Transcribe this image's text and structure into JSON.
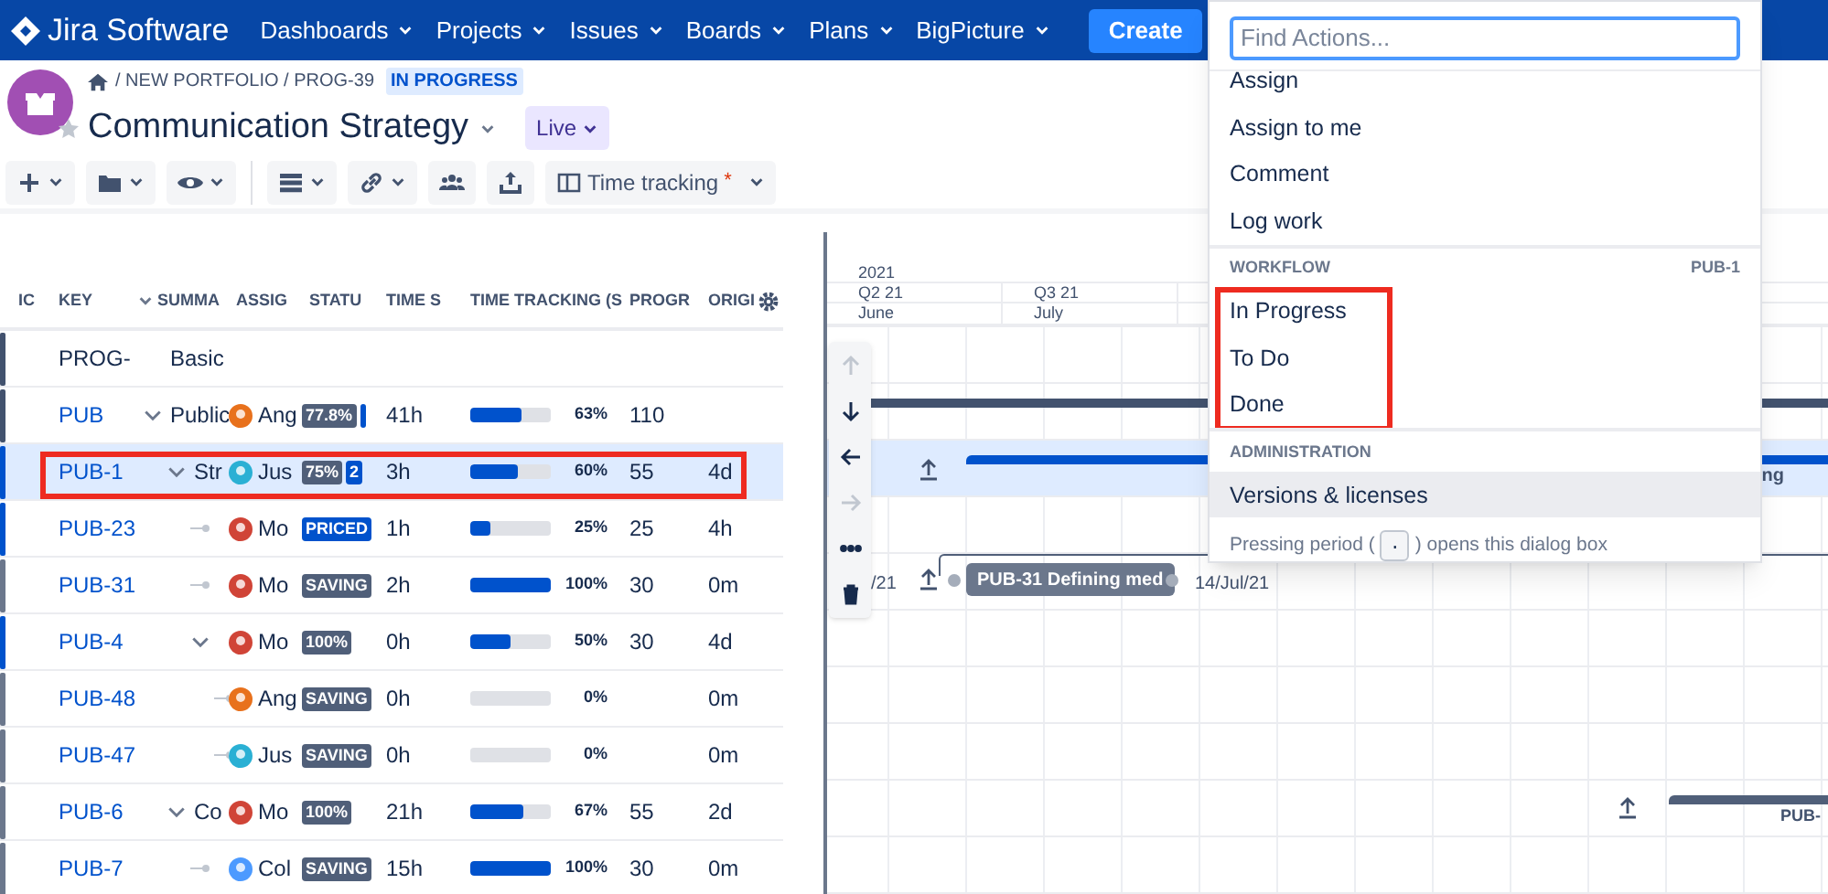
{
  "nav": {
    "logo": "Jira Software",
    "menus": [
      "Dashboards",
      "Projects",
      "Issues",
      "Boards",
      "Plans",
      "BigPicture"
    ],
    "create": "Create"
  },
  "header": {
    "breadcrumb": "/ NEW PORTFOLIO / PROG-39",
    "status": "IN PROGRESS",
    "title": "Communication Strategy",
    "mode": "Live"
  },
  "toolbar": [
    {
      "kind": "add",
      "dropdown": true
    },
    {
      "kind": "folder",
      "dropdown": true
    },
    {
      "kind": "view",
      "dropdown": true
    },
    {
      "kind": "divider"
    },
    {
      "kind": "rows",
      "dropdown": true
    },
    {
      "kind": "link",
      "dropdown": true
    },
    {
      "kind": "people",
      "dropdown": false
    },
    {
      "kind": "export",
      "dropdown": false
    },
    {
      "kind": "columns",
      "label": "Time tracking",
      "marker": "*",
      "dropdown": true
    }
  ],
  "table": {
    "columns": [
      "IC",
      "KEY",
      "SUMMA",
      "ASSIG",
      "STATU",
      "TIME S",
      "TIME TRACKING (S",
      "PROGR",
      "ORIGI"
    ],
    "rows": [
      {
        "kind": "program",
        "key": "PROG-",
        "summary": "Basic",
        "selected": false,
        "annotated": false,
        "color": "#42526e"
      },
      {
        "kind": "issue",
        "key": "PUB",
        "summary": "Public",
        "assignee": {
          "name": "Ang",
          "color": "#e8711c"
        },
        "status": [
          {
            "text": "77.8%",
            "color": "#505f79"
          },
          {
            "color": "#0052cc"
          }
        ],
        "time_spent": "41h",
        "level": 0.63,
        "percent": "63%",
        "progress": "110",
        "selected": false,
        "annotated": false,
        "color": "#42526e",
        "expanded": true,
        "children": [
          {
            "kind": "issue",
            "key": "PUB-1",
            "summary": "Str",
            "assignee": {
              "name": "Jus",
              "color": "#2ab0d4"
            },
            "status": [
              {
                "text": "75%",
                "color": "#505f79"
              },
              {
                "text": "2",
                "color": "#0052cc"
              }
            ],
            "time_spent": "3h",
            "level": 0.6,
            "percent": "60%",
            "progress": "55",
            "original": "4d",
            "selected": true,
            "annotated": true,
            "color": "#0052cc",
            "expanded": true,
            "children": [
              {
                "kind": "issue",
                "key": "PUB-23",
                "assignee": {
                  "name": "Mo",
                  "color": "#d04437"
                },
                "status": [
                  {
                    "text": "PRICED",
                    "color": "#0052cc"
                  }
                ],
                "time_spent": "1h",
                "level": 0.25,
                "percent": "25%",
                "progress": "25",
                "original": "4h",
                "selected": false,
                "annotated": false,
                "color": "#0052cc"
              },
              {
                "kind": "issue",
                "key": "PUB-31",
                "assignee": {
                  "name": "Mo",
                  "color": "#d04437"
                },
                "status": [
                  {
                    "text": "SAVING",
                    "color": "#505f79"
                  }
                ],
                "time_spent": "2h",
                "level": 1,
                "percent": "100%",
                "progress": "30",
                "original": "0m",
                "selected": false,
                "annotated": false,
                "color": "#6b778c"
              },
              {
                "kind": "issue",
                "key": "PUB-4",
                "assignee": {
                  "name": "Mo",
                  "color": "#d04437"
                },
                "status": [
                  {
                    "text": "100%",
                    "color": "#505f79"
                  }
                ],
                "time_spent": "0h",
                "level": 0.5,
                "percent": "50%",
                "progress": "30",
                "original": "4d",
                "selected": false,
                "annotated": false,
                "color": "#0052cc",
                "expanded": true,
                "children": [
                  {
                    "kind": "issue",
                    "key": "PUB-48",
                    "assignee": {
                      "name": "Ang",
                      "color": "#e8711c"
                    },
                    "status": [
                      {
                        "text": "SAVING",
                        "color": "#505f79"
                      }
                    ],
                    "time_spent": "0h",
                    "level": 0,
                    "percent": "0%",
                    "original": "0m",
                    "selected": false,
                    "annotated": false,
                    "color": "#6b778c"
                  },
                  {
                    "kind": "issue",
                    "key": "PUB-47",
                    "assignee": {
                      "name": "Jus",
                      "color": "#2ab0d4"
                    },
                    "status": [
                      {
                        "text": "SAVING",
                        "color": "#505f79"
                      }
                    ],
                    "time_spent": "0h",
                    "level": 0,
                    "percent": "0%",
                    "original": "0m",
                    "selected": false,
                    "annotated": false,
                    "color": "#6b778c"
                  }
                ]
              }
            ]
          },
          {
            "kind": "issue",
            "key": "PUB-6",
            "summary": "Co",
            "assignee": {
              "name": "Mo",
              "color": "#d04437"
            },
            "status": [
              {
                "text": "100%",
                "color": "#505f79"
              }
            ],
            "time_spent": "21h",
            "level": 0.67,
            "percent": "67%",
            "progress": "55",
            "original": "2d",
            "selected": false,
            "annotated": false,
            "color": "#6b778c",
            "expanded": true,
            "children": [
              {
                "kind": "issue",
                "key": "PUB-7",
                "assignee": {
                  "name": "Col",
                  "color": "#4c9aff"
                },
                "status": [
                  {
                    "text": "SAVING",
                    "color": "#505f79"
                  }
                ],
                "time_spent": "15h",
                "level": 1,
                "percent": "100%",
                "progress": "30",
                "original": "0m",
                "selected": false,
                "annotated": false,
                "color": "#6b778c"
              }
            ]
          }
        ]
      }
    ]
  },
  "gantt": {
    "year": "2021",
    "quarters": [
      "Q2 21",
      "Q3 21"
    ],
    "months": [
      "June",
      "July"
    ],
    "tools": [
      {
        "kind": "up",
        "disabled": true
      },
      {
        "kind": "down",
        "disabled": false
      },
      {
        "kind": "left",
        "disabled": false
      },
      {
        "kind": "right",
        "disabled": true
      },
      {
        "kind": "more",
        "disabled": false
      },
      {
        "kind": "delete",
        "disabled": false
      }
    ],
    "bars": [
      {
        "kind": "summary"
      },
      {
        "kind": "active",
        "label": "ng"
      },
      {
        "kind": "milestone",
        "start": "/21",
        "chip_key": "PUB-31",
        "chip_title": "Defining med",
        "end": "14/Jul/21"
      },
      {
        "kind": "summary",
        "label": "PUB-"
      }
    ]
  },
  "actions": {
    "placeholder": "Find Actions...",
    "sections": [
      {
        "items": [
          {
            "label": "Assign",
            "selected": false
          },
          {
            "label": "Assign to me",
            "selected": false
          },
          {
            "label": "Comment",
            "selected": false
          },
          {
            "label": "Log work",
            "selected": false
          }
        ]
      },
      {
        "title": "WORKFLOW",
        "context": "PUB-1",
        "annotated": true,
        "items": [
          {
            "label": "In Progress",
            "selected": false
          },
          {
            "label": "To Do",
            "selected": false
          },
          {
            "label": "Done",
            "selected": false
          }
        ]
      },
      {
        "title": "ADMINISTRATION",
        "annotated": false,
        "items": [
          {
            "label": "Versions & licenses",
            "selected": true
          }
        ]
      }
    ],
    "footer_before": "Pressing period (",
    "key": ".",
    "footer_after": ") opens this dialog box"
  }
}
